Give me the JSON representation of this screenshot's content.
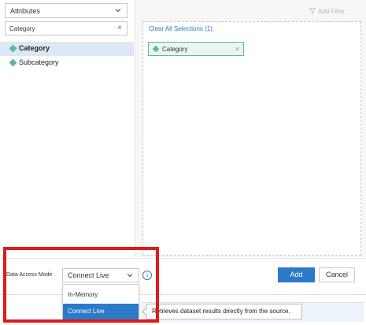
{
  "left_panel": {
    "dropdown_value": "Attributes",
    "search_value": "Category",
    "items": [
      {
        "label": "Category",
        "selected": true
      },
      {
        "label": "Subcategory",
        "selected": false
      }
    ]
  },
  "right_panel": {
    "add_filter_label": "Add Filter...",
    "clear_all_label": "Clear All Selections (1)",
    "chip_label": "Category"
  },
  "footer": {
    "data_access_mode_label": "Data Access Mode",
    "selected_mode": "Connect Live",
    "add_label": "Add",
    "cancel_label": "Cancel",
    "info_glyph": "i"
  },
  "mode_dropdown": {
    "options": [
      {
        "label": "In-Memory",
        "active": false
      },
      {
        "label": "Connect Live",
        "active": true
      }
    ]
  },
  "tooltip": {
    "text": "Retrieves dataset results directly from the source."
  },
  "colors": {
    "accent": "#2a7ac8",
    "attribute": "#5cb89a",
    "highlight": "#e01b1b"
  }
}
